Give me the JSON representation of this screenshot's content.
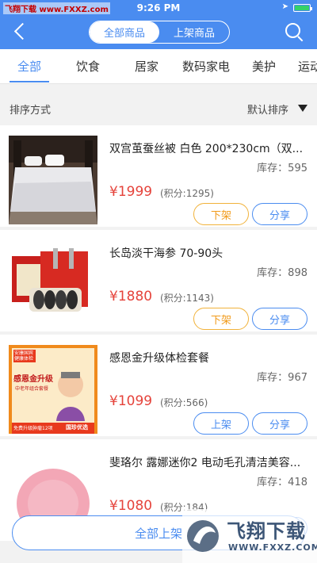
{
  "status_bar": {
    "watermark": "飞翔下载 www.FXXZ.com",
    "time": "9:26 PM"
  },
  "header": {
    "tabs": [
      {
        "label": "全部商品"
      },
      {
        "label": "上架商品"
      }
    ]
  },
  "categories": [
    "全部",
    "饮食",
    "居家",
    "数码家电",
    "美护",
    "运动"
  ],
  "sort": {
    "label": "排序方式",
    "value": "默认排序"
  },
  "products": [
    {
      "title": "双宫茧蚕丝被 白色 200*230cm（双...",
      "stock": "库存：595",
      "price": "¥1999",
      "points": "(积分:1295)",
      "btn_left": "下架",
      "btn_right": "分享"
    },
    {
      "title": "长岛淡干海参 70-90头",
      "stock": "库存：898",
      "price": "¥1880",
      "points": "(积分:1143)",
      "btn_left": "下架",
      "btn_right": "分享"
    },
    {
      "title": "感恩金升级体检套餐",
      "stock": "库存：967",
      "price": "¥1099",
      "points": "(积分:566)",
      "btn_left": "上架",
      "btn_right": "分享"
    },
    {
      "title": "斐珞尔 露娜迷你2 电动毛孔清洁美容...",
      "stock": "库存：418",
      "price": "¥1080",
      "points": "(积分:184)",
      "btn_left": "上架",
      "btn_right": "分享"
    }
  ],
  "thumb_text": {
    "checkup_top": "安康国宾健康体检",
    "checkup_title": "感恩金升级",
    "checkup_sub": "中老年组合套餐",
    "checkup_bottom": "免费升级肿瘤12项",
    "checkup_brand": "国珍优选"
  },
  "bottom": {
    "label": "全部上架"
  },
  "logo": {
    "text": "飞翔下载",
    "url": "WWW.FXXZ.COM"
  },
  "colors": {
    "primary": "#4a8cf0",
    "price": "#e5433b",
    "unlist": "#f19a1a"
  }
}
